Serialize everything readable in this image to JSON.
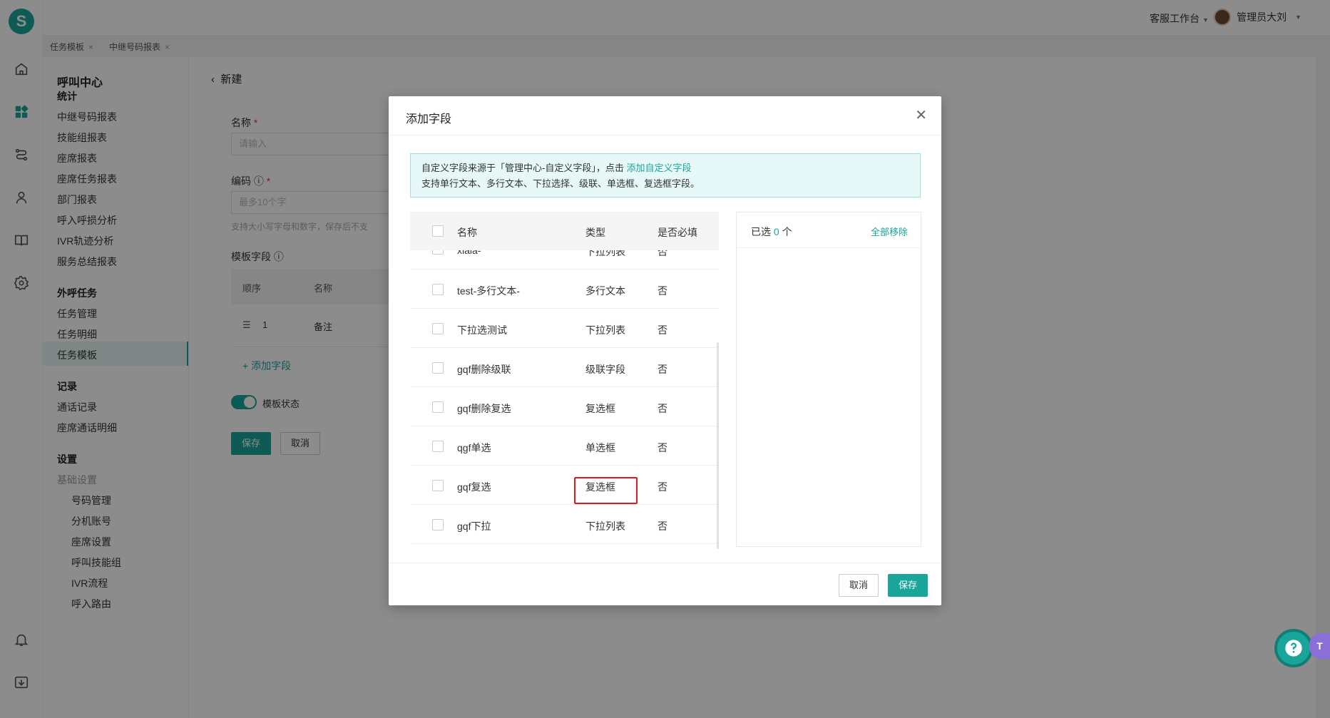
{
  "app": {
    "logo_letter": "S"
  },
  "header": {
    "workbench": "客服工作台",
    "user_name": "管理员大刘"
  },
  "tabs": [
    {
      "label": "任务模板"
    },
    {
      "label": "中继号码报表"
    }
  ],
  "sidebar": {
    "title": "呼叫中心",
    "groups": [
      {
        "label": "统计",
        "items": [
          "中继号码报表",
          "技能组报表",
          "座席报表",
          "座席任务报表",
          "部门报表",
          "呼入呼损分析",
          "IVR轨迹分析",
          "服务总结报表"
        ]
      },
      {
        "label": "外呼任务",
        "items": [
          "任务管理",
          "任务明细",
          "任务模板"
        ]
      },
      {
        "label": "记录",
        "items": [
          "通话记录",
          "座席通话明细"
        ]
      },
      {
        "label": "设置",
        "items": [
          "基础设置",
          "号码管理",
          "分机账号",
          "座席设置",
          "呼叫技能组",
          "IVR流程",
          "呼入路由"
        ]
      }
    ],
    "active_item": "任务模板"
  },
  "page": {
    "back_title": "新建",
    "name_label": "名称",
    "name_placeholder": "请输入",
    "code_label": "编码",
    "code_placeholder": "最多10个字",
    "code_hint": "支持大小写字母和数字，保存后不支",
    "template_fields_label": "模板字段",
    "table_cols": {
      "order": "顺序",
      "name": "名称"
    },
    "table_row": {
      "order": "1",
      "name": "备注"
    },
    "add_field": "+ 添加字段",
    "status_label": "模板状态",
    "save": "保存",
    "cancel": "取消"
  },
  "modal": {
    "title": "添加字段",
    "notice_line1_prefix": "自定义字段来源于「管理中心-自定义字段」，点击",
    "notice_link": "添加自定义字段",
    "notice_line2": "支持单行文本、多行文本、下拉选择、级联、单选框、复选框字段。",
    "columns": {
      "name": "名称",
      "type": "类型",
      "required": "是否必填"
    },
    "rows": [
      {
        "name": "xiala-",
        "type": "下拉列表",
        "required": "否"
      },
      {
        "name": "test-多行文本-",
        "type": "多行文本",
        "required": "否"
      },
      {
        "name": "下拉选测试",
        "type": "下拉列表",
        "required": "否"
      },
      {
        "name": "gqf删除级联",
        "type": "级联字段",
        "required": "否"
      },
      {
        "name": "gqf删除复选",
        "type": "复选框",
        "required": "否"
      },
      {
        "name": "qgf单选",
        "type": "单选框",
        "required": "否"
      },
      {
        "name": "gqf复选",
        "type": "复选框",
        "required": "否"
      },
      {
        "name": "gqf下拉",
        "type": "下拉列表",
        "required": "否"
      }
    ],
    "selected_prefix": "已选",
    "selected_count": "0",
    "selected_suffix": "个",
    "remove_all": "全部移除",
    "cancel": "取消",
    "save": "保存"
  },
  "help": {
    "tag": "T",
    "icon": "question-icon"
  },
  "colors": {
    "accent": "#1aa59a",
    "highlight": "#e4191f",
    "overlay": "rgba(0,0,0,0.45)"
  }
}
